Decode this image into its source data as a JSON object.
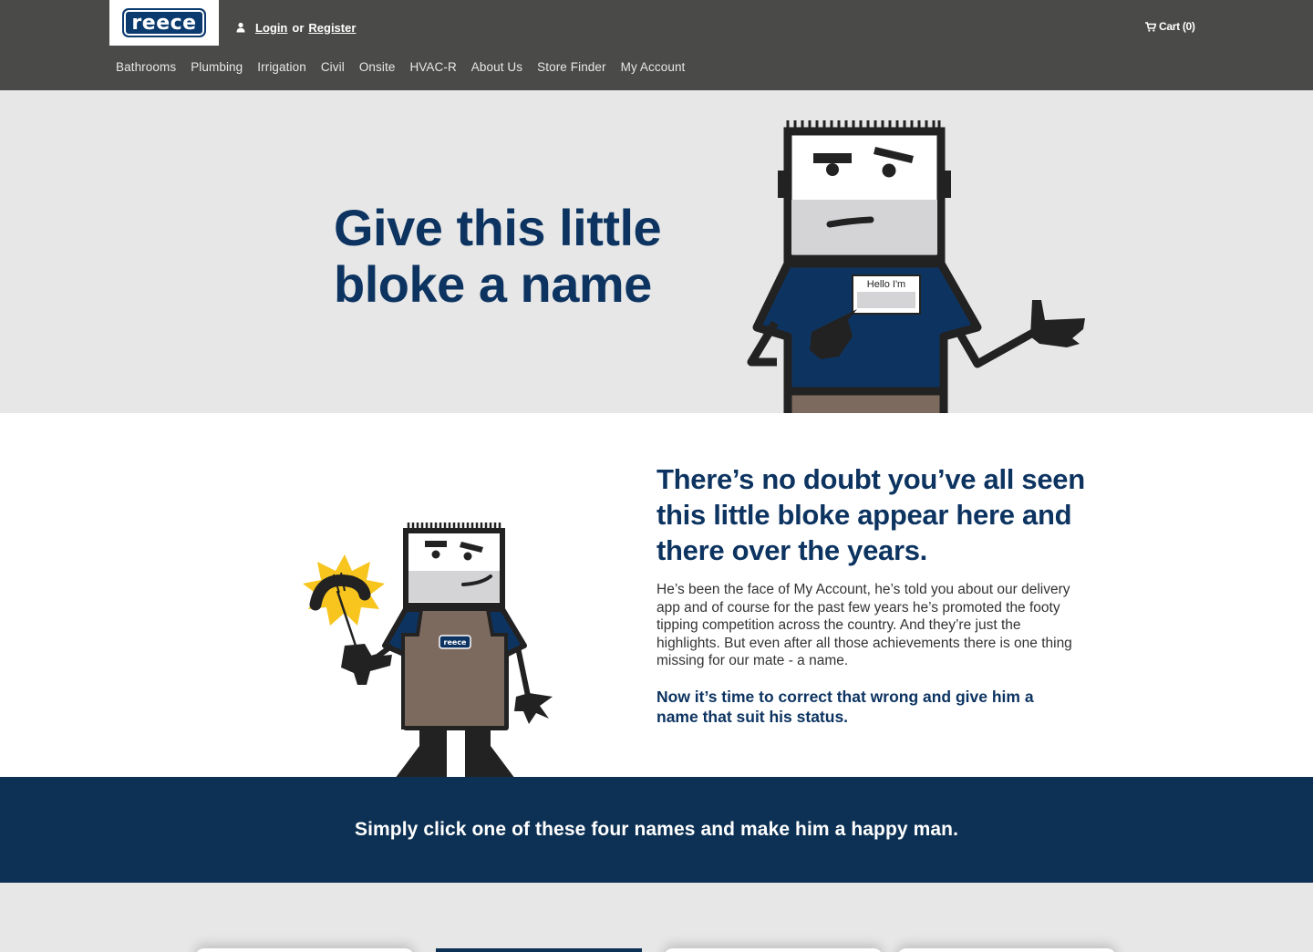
{
  "header": {
    "logo_text": "reece",
    "login_label": "Login",
    "or_label": "or",
    "register_label": "Register",
    "cart_label": "Cart (0)",
    "user_icon": "user-icon",
    "cart_icon": "cart-icon"
  },
  "nav": {
    "items": [
      {
        "label": "Bathrooms"
      },
      {
        "label": "Plumbing"
      },
      {
        "label": "Irrigation"
      },
      {
        "label": "Civil"
      },
      {
        "label": "Onsite"
      },
      {
        "label": "HVAC-R"
      },
      {
        "label": "About Us"
      },
      {
        "label": "Store Finder"
      },
      {
        "label": "My Account"
      }
    ]
  },
  "hero": {
    "title_line1": "Give this little",
    "title_line2": "bloke a name",
    "name_tag": "Hello I'm"
  },
  "intro": {
    "heading": "There’s no doubt you’ve all seen this little bloke appear here and there over the years.",
    "body": "He’s been the face of My Account, he’s told you about our delivery app and of course for the past few years he’s promoted the footy tipping competition across the country. And they’re just the highlights. But even after all those achievements there is one thing missing for our mate - a name.",
    "cta": "Now it’s time to correct that wrong and give him a name that suit his status.",
    "apron_logo": "reece"
  },
  "banner": {
    "text": "Simply click one of these four names and make him a happy man."
  },
  "colors": {
    "header_bg": "#4a4a48",
    "brand_blue": "#0d3461",
    "banner_bg": "#0d3154",
    "hero_bg": "#e7e7e7"
  }
}
